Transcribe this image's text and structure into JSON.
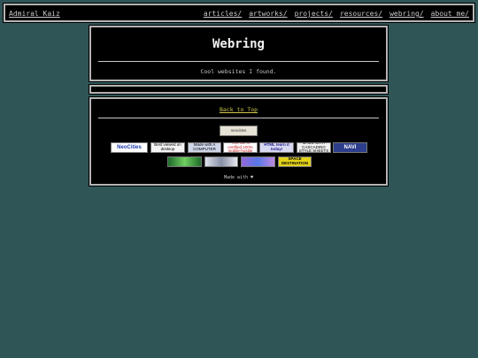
{
  "site": {
    "brand": "Admiral Kaiz"
  },
  "nav": [
    "articles/",
    "artworks/",
    "projects/",
    "resources/",
    "webring/",
    "about_me/"
  ],
  "header": {
    "title": "Webring",
    "subtitle": "Cool websites I found."
  },
  "footer": {
    "back_to_top": "Back to Top",
    "made_with": "Made with"
  },
  "badges": {
    "neocities_small": "neocities",
    "neocities": "NeoCities",
    "desktop": "Best viewed on desktop",
    "computer": "Made with A COMPUTER",
    "mobile": "This site is certified 100% mobile-hostile",
    "html": "HTML learn it today!",
    "css": "MADE WITH CASCADING STYLE SHEETS",
    "navi": "NAVI",
    "space": "SPACE DESTINATION"
  },
  "colors": {
    "background": "#2f5557",
    "panel": "#000000",
    "link": "#d2c84a"
  }
}
